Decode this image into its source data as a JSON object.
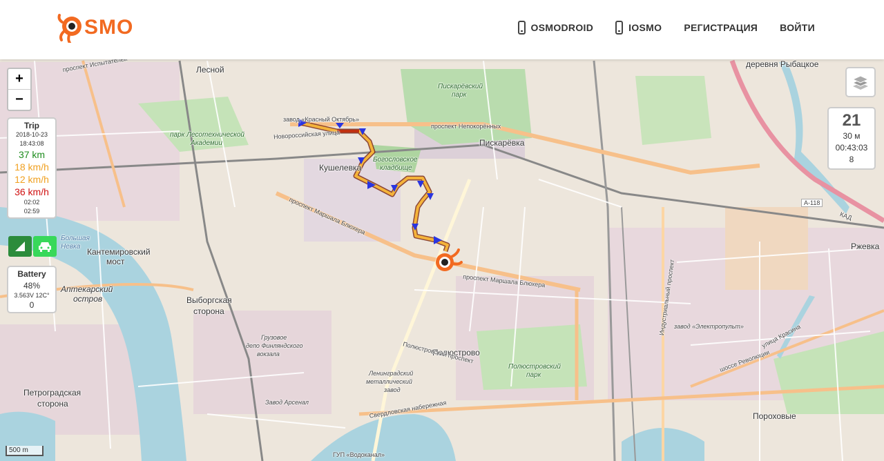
{
  "header": {
    "logo_text": "SMO",
    "nav": [
      {
        "label": "OSMODROID",
        "icon": "phone-icon"
      },
      {
        "label": "IOSMO",
        "icon": "phone-icon"
      },
      {
        "label": "РЕГИСТРАЦИЯ"
      },
      {
        "label": "ВОЙТИ"
      }
    ]
  },
  "zoom": {
    "in": "+",
    "out": "−"
  },
  "trip": {
    "title": "Trip",
    "date": "2018-10-23",
    "time": "18:43:08",
    "distance": "37 km",
    "avg_speed": "18 km/h",
    "speed2": "12 km/h",
    "max_speed": "36 km/h",
    "t1": "02:02",
    "t2": "02:59",
    "colors": {
      "distance": "#1e8c1e",
      "avg_speed": "#f0a020",
      "speed2": "#f0a020",
      "max_speed": "#d01010"
    }
  },
  "mode_buttons": [
    "signal-icon",
    "car-icon"
  ],
  "battery": {
    "title": "Battery",
    "percent": "48%",
    "detail": "3.563V 12C°",
    "count": "0"
  },
  "info": {
    "big": "21",
    "line1": "30 м",
    "line2": "00:43:03",
    "line3": "8"
  },
  "scale": "500 m",
  "map_labels": {
    "lesnoy": "Лесной",
    "piskarevka": "Пискарёвка",
    "kushelevka": "Кушелевка",
    "kantemirovsky": "Кантемировский",
    "most": "мост",
    "aptekarsky": "Аптекарский",
    "ostrov": "остров",
    "vyborgskaya": "Выборгская",
    "storona": "сторона",
    "polyustrovo": "Полюстрово",
    "petrogradskaya": "Петроградская",
    "storona2": "сторона",
    "porohovye": "Пороховые",
    "rybatskoe": "деревня Рыбацкое",
    "rzhevka": "Ржевка",
    "piskarevsky_park": "Пискарёвский",
    "park": "парк",
    "bogoslovskoe": "Богословское",
    "kladbishe": "кладбище",
    "park_lesotech": "парк Лесотехнической",
    "akademii": "Академии",
    "polyustrovsky_park": "Полюстровский",
    "park2": "парк",
    "bolshaya_nevka": "Большая",
    "nevka": "Невка",
    "pr_marshala": "проспект Маршала Блюхера",
    "pr_marshala2": "проспект Маршала Блюхера",
    "pr_nepokorennyh": "проспект Непокорённых",
    "novorossiyskaya": "Новороссийская улица",
    "sverdlovskaya": "Свердловская набережная",
    "zavod_arsenal": "Завод Арсенал",
    "leningradsky_zavod": "Ленинградский",
    "metallichesky": "металлический",
    "zavod": "завод",
    "zavod_elektropult": "завод «Электропульт»",
    "gruzovoe_depo": "Грузовое",
    "depo_finl": "депо Финляндского",
    "vokzala": "вокзала",
    "polyustrovsky_prospekt": "Полюстровский проспект",
    "industrialny": "Индустриальный проспект",
    "a118": "А-118",
    "kad": "КАД",
    "ulitsa_krasina": "улица Красина",
    "shosse_revolutsii": "шоссе Революции",
    "gup_vodokanal": "ГУП «Водоканал»",
    "zavod_krasny_oktyabr": "завод «Красный Октябрь»",
    "ispytateley": "проспект Испытателей"
  }
}
